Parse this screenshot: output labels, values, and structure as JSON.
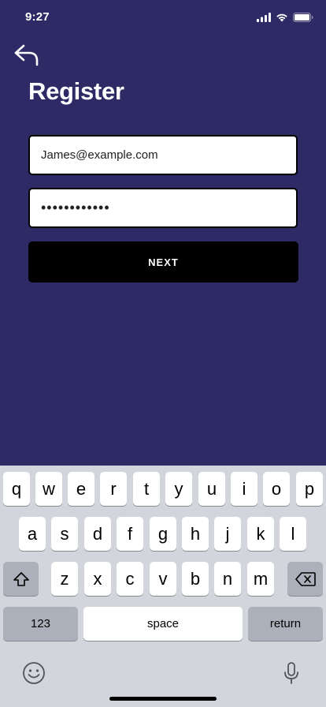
{
  "status_bar": {
    "time": "9:27",
    "icons": [
      "cellular-signal-icon",
      "wifi-icon",
      "battery-icon"
    ]
  },
  "nav": {
    "back_icon": "back-arrow-icon"
  },
  "page": {
    "title": "Register"
  },
  "form": {
    "email_value": "James@example.com",
    "password_value": "••••••••••••",
    "next_label": "NEXT"
  },
  "keyboard": {
    "row1": [
      "q",
      "w",
      "e",
      "r",
      "t",
      "y",
      "u",
      "i",
      "o",
      "p"
    ],
    "row2": [
      "a",
      "s",
      "d",
      "f",
      "g",
      "h",
      "j",
      "k",
      "l"
    ],
    "row3": [
      "z",
      "x",
      "c",
      "v",
      "b",
      "n",
      "m"
    ],
    "numbers_label": "123",
    "space_label": "space",
    "return_label": "return",
    "icons": [
      "shift-icon",
      "delete-icon",
      "emoji-icon",
      "microphone-icon"
    ]
  },
  "colors": {
    "background": "#2e2a66",
    "button": "#000000",
    "keyboard_bg": "#d2d5db"
  }
}
